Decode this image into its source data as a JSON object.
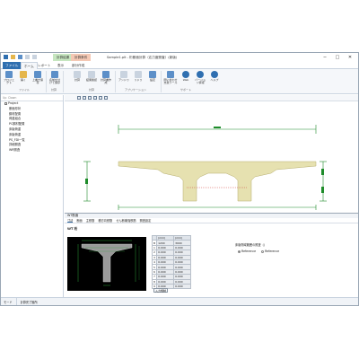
{
  "app": {
    "title": "Sample1.plt - 桁断面計算（応力度照査）(新版)"
  },
  "title_context_tabs": [
    "計算結果",
    "計算条件"
  ],
  "window_controls": {
    "minimize": "─",
    "maximize": "□",
    "close": "✕"
  },
  "tabs": [
    "ファイル",
    "ホーム",
    "レポート",
    "表示",
    "部分作成"
  ],
  "ribbon": {
    "buttons": [
      {
        "label": "プロジェクト",
        "icon": "project-icon",
        "color": "#5c8fc8"
      },
      {
        "label": "開く",
        "icon": "open-folder-icon",
        "color": "#e5b64b"
      },
      {
        "label": "上書き保存",
        "icon": "save-icon",
        "color": "#5c8fc8"
      },
      {
        "label": "名前を付けて保存",
        "icon": "save-as-icon",
        "color": "#5c8fc8"
      },
      {
        "label": "計算",
        "icon": "calculate-icon",
        "color": "#c9d3df"
      },
      {
        "label": "結果確認",
        "icon": "check-icon",
        "color": "#c9d3df"
      },
      {
        "label": "計算書作成",
        "icon": "report-icon",
        "color": "#5c8fc8"
      },
      {
        "label": "アンドゥ",
        "icon": "undo-icon",
        "color": "#c9d3df"
      },
      {
        "label": "リドゥ",
        "icon": "redo-icon",
        "color": "#c9d3df"
      },
      {
        "label": "設定",
        "icon": "gear-icon",
        "color": "#5c8fc8"
      },
      {
        "label": "問い合わせ支援ツール",
        "icon": "support-icon",
        "color": "#5c8fc8"
      },
      {
        "label": "Web",
        "icon": "web-icon",
        "color": "#2f6fb0"
      },
      {
        "label": "バージョン情報",
        "icon": "version-icon",
        "color": "#2f6fb0"
      },
      {
        "label": "ヘルプ",
        "icon": "help-icon",
        "color": "#2f6fb0"
      }
    ],
    "groups": [
      "ファイル",
      "計算",
      "計算",
      "アプリケーション",
      "サポート"
    ]
  },
  "tree": {
    "tools": [
      "Up",
      "Down"
    ],
    "root": "Project",
    "items": [
      "断面形状",
      "鋼材配置",
      "荷重組合",
      "PC鋼材配置",
      "床版荷重",
      "床版荷重",
      "PS_FDI一覧",
      "詳細照査",
      "WR照査"
    ]
  },
  "bottom": {
    "title": "WT断面",
    "subtabs": [
      "寸法",
      "断面",
      "主鉄筋",
      "横方向鉄筋",
      "せん断補強鉄筋",
      "照査設定"
    ],
    "section_label": "WT 桁",
    "grid": {
      "headers": [
        "(mm)",
        "(mm)"
      ],
      "rows": [
        {
          "name": "B",
          "v1": "1200",
          "v2": "3000"
        },
        {
          "name": "1",
          "v1": "0.000",
          "v2": "0.000"
        },
        {
          "name": "2",
          "v1": "0.000",
          "v2": "0.000"
        },
        {
          "name": "3",
          "v1": "0.000",
          "v2": "0.000"
        },
        {
          "name": "4",
          "v1": "0.000",
          "v2": "0.000"
        },
        {
          "name": "5",
          "v1": "0.000",
          "v2": "0.000"
        },
        {
          "name": "6",
          "v1": "0.000",
          "v2": "0.000"
        },
        {
          "name": "7",
          "v1": "0.000",
          "v2": "0.000"
        },
        {
          "name": "8",
          "v1": "0.000",
          "v2": "0.000"
        },
        {
          "name": "9",
          "v1": "0.000",
          "v2": "0.000"
        }
      ]
    },
    "input_button": "入力規制",
    "options_label": "床版剛域範囲の照査（）",
    "options": [
      "Reference",
      "Reference"
    ]
  },
  "status_bar": [
    "モード",
    "計算完了箇所"
  ]
}
